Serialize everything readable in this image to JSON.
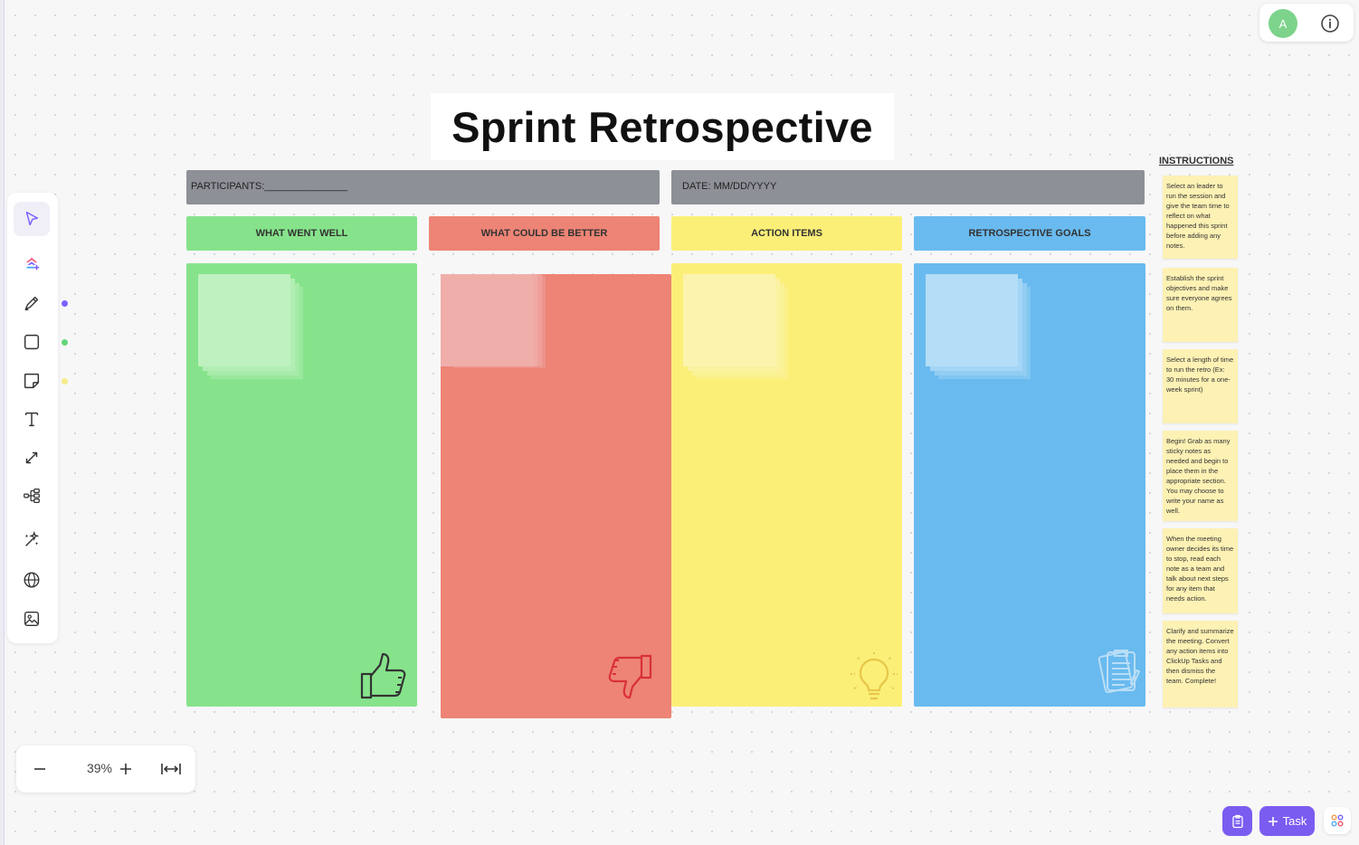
{
  "board": {
    "title": "Sprint Retrospective",
    "participants_label": "PARTICIPANTS:_______________",
    "date_label": "DATE: MM/DD/YYYY",
    "columns": [
      {
        "label": "WHAT WENT WELL",
        "icon": "thumbs-up-icon",
        "color": "#86e38b"
      },
      {
        "label": "WHAT COULD BE BETTER",
        "icon": "thumbs-down-icon",
        "color": "#ed8475"
      },
      {
        "label": "ACTION ITEMS",
        "icon": "light-bulb-icon",
        "color": "#fbef78"
      },
      {
        "label": "RETROSPECTIVE GOALS",
        "icon": "clipboard-icon",
        "color": "#69baef"
      }
    ]
  },
  "instructions": {
    "title": "INSTRUCTIONS",
    "notes": [
      "Select an leader to run the session and give the team time to reflect on what happened this sprint before adding any notes.",
      "Establish the sprint objectives and make sure everyone agrees on them.",
      "Select a length of time to run the retro (Ex: 30 minutes for a one-week sprint)",
      "Begin! Grab as many sticky notes as needed and begin to place them in the appropriate section. You may choose to write your name as well.",
      "When the meeting owner decides its time to stop, read each note as a team and talk about next steps for any item that needs action.",
      "Clarify and summarize the meeting. Convert any action items into ClickUp Tasks and then dismiss the team. Complete!"
    ]
  },
  "user": {
    "avatar_initial": "A"
  },
  "zoom": {
    "level": "39%"
  },
  "actions": {
    "task_label": "Task"
  },
  "toolbar": {
    "tools": [
      "select-tool",
      "ai-brain-tool",
      "pen-tool",
      "shape-tool",
      "sticky-note-tool",
      "text-tool",
      "connector-tool",
      "mind-map-tool",
      "magic-tool",
      "web-embed-tool",
      "image-tool"
    ],
    "dot_colors": {
      "pen": "#7b61ff",
      "shape": "#63d67a",
      "sticky": "#f5ec8a"
    }
  }
}
